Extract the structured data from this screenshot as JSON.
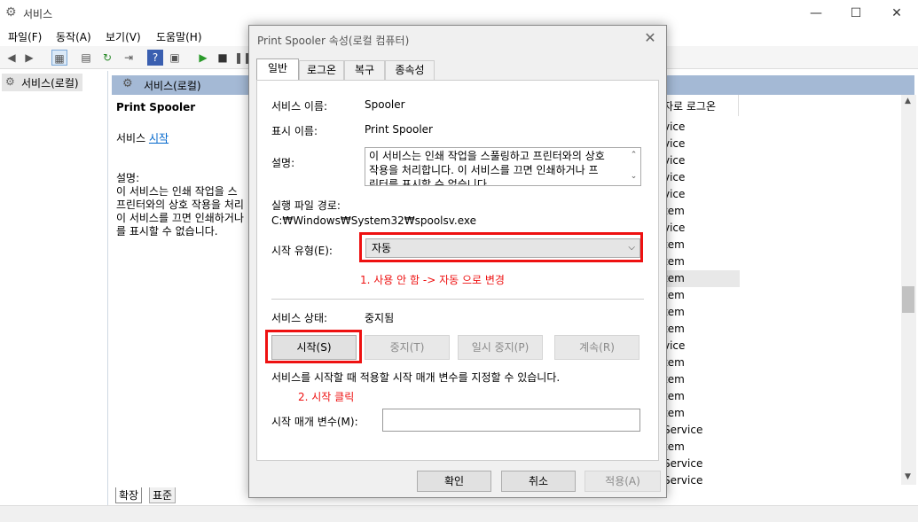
{
  "window": {
    "title": "서비스",
    "controls": {
      "minimize": "—",
      "maximize": "☐",
      "close": "✕"
    }
  },
  "menu": [
    "파일(F)",
    "동작(A)",
    "보기(V)",
    "도움말(H)"
  ],
  "tree": {
    "item": "서비스(로컬)"
  },
  "right_header": "서비스(로컬)",
  "description_pane": {
    "service_name": "Print Spooler",
    "start_prefix": "서비스",
    "start_link": "시작",
    "desc_label": "설명:",
    "desc_lines": [
      "이 서비스는 인쇄 작업을 스",
      "프린터와의 상호 작용을 처리",
      "이 서비스를 끄면 인쇄하거나",
      "를 표시할 수 없습니다."
    ]
  },
  "list": {
    "header": "자로 로그온",
    "rows": [
      "vice",
      "vice",
      "vice",
      "vice",
      "vice",
      "tem",
      "vice",
      "tem",
      "tem",
      "tem",
      "tem",
      "tem",
      "tem",
      "vice",
      "tem",
      "tem",
      "tem",
      "tem",
      "Service",
      "tem",
      "Service",
      "Service"
    ]
  },
  "bottom_tabs": [
    "확장",
    "표준"
  ],
  "dialog": {
    "title": "Print Spooler 속성(로컬 컴퓨터)",
    "tabs": [
      "일반",
      "로그온",
      "복구",
      "종속성"
    ],
    "service_name_label": "서비스 이름:",
    "service_name_value": "Spooler",
    "display_name_label": "표시 이름:",
    "display_name_value": "Print Spooler",
    "description_label": "설명:",
    "description_lines": [
      "이 서비스는 인쇄 작업을 스풀링하고 프린터와의 상호",
      "작용을 처리합니다. 이 서비스를 끄면 인쇄하거나 프",
      "린터를 표시할 수 없습니다."
    ],
    "exe_path_label": "실행 파일 경로:",
    "exe_path_value": "C:₩Windows₩System32₩spoolsv.exe",
    "startup_type_label": "시작 유형(E):",
    "startup_type_value": "자동",
    "annotation_1": "1. 사용 안 함 -> 자동 으로 변경",
    "status_label": "서비스 상태:",
    "status_value": "중지됨",
    "buttons": {
      "start": "시작(S)",
      "stop": "중지(T)",
      "pause": "일시 중지(P)",
      "resume": "계속(R)"
    },
    "hint": "서비스를 시작할 때 적용할 시작 매개 변수를 지정할 수 있습니다.",
    "annotation_2": "2. 시작 클릭",
    "param_label": "시작 매개 변수(M):",
    "param_value": "",
    "footer": {
      "ok": "확인",
      "cancel": "취소",
      "apply": "적용(A)"
    }
  }
}
